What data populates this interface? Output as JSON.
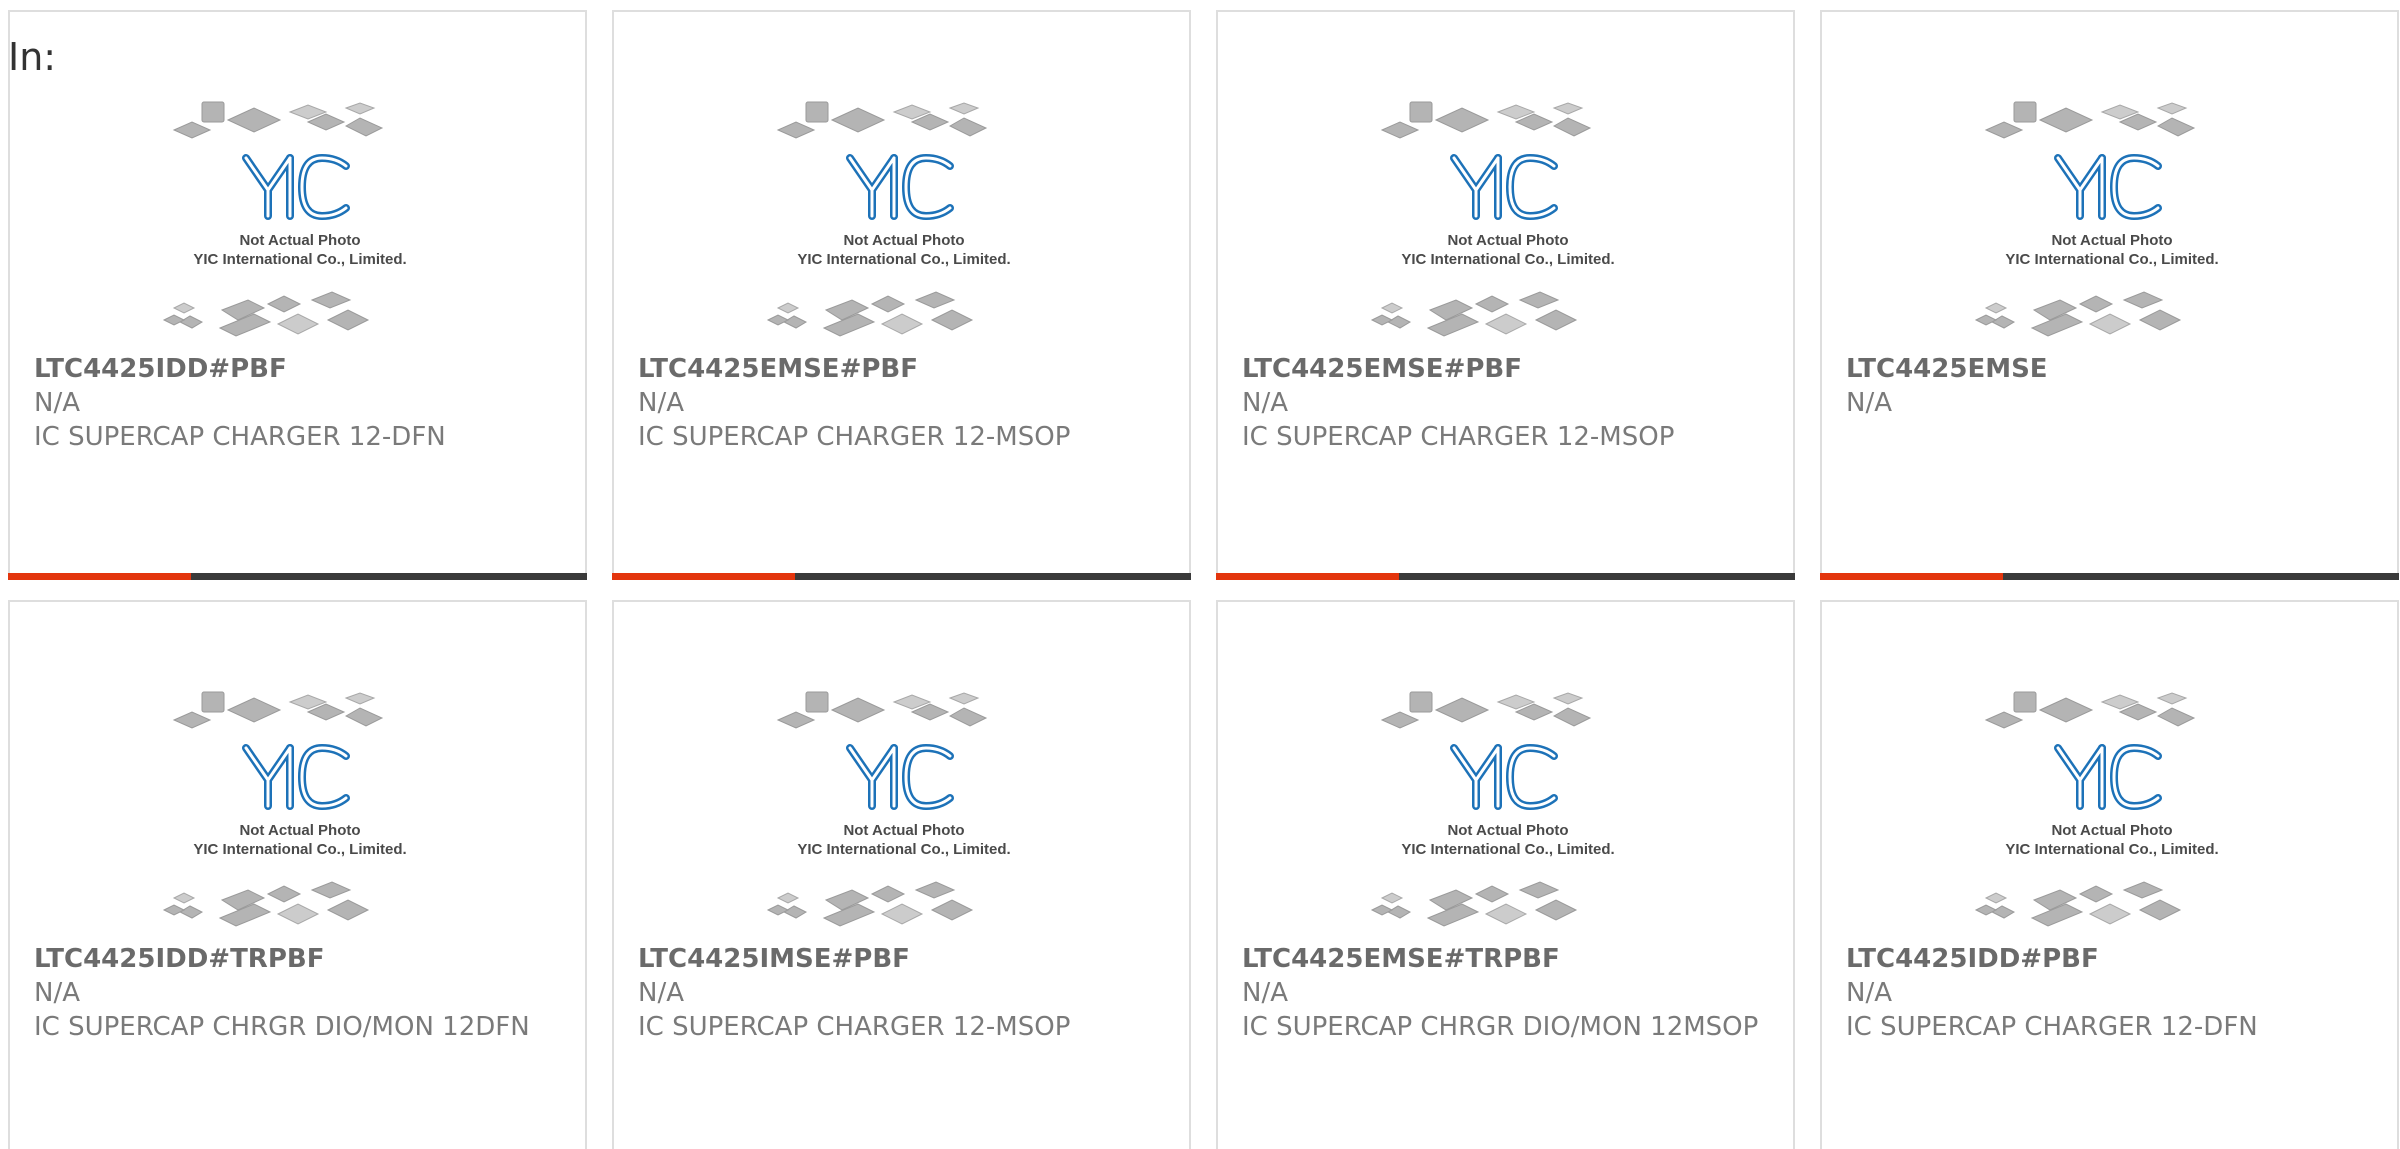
{
  "header": {
    "in_label": "In:"
  },
  "placeholder": {
    "line1": "Not Actual Photo",
    "line2": "YIC International Co., Limited.",
    "logo_text": "YIC"
  },
  "colors": {
    "accent": "#e3350d",
    "bar": "#3a3a3a",
    "logo_blue": "#1d72b8",
    "text": "#6e6e6e",
    "border": "#dedede"
  },
  "products": [
    {
      "part_number": "LTC4425IDD#PBF",
      "manufacturer": "N/A",
      "description": "IC SUPERCAP CHARGER 12-DFN"
    },
    {
      "part_number": "LTC4425EMSE#PBF",
      "manufacturer": "N/A",
      "description": "IC SUPERCAP CHARGER 12-MSOP"
    },
    {
      "part_number": "LTC4425EMSE#PBF",
      "manufacturer": "N/A",
      "description": "IC SUPERCAP CHARGER 12-MSOP"
    },
    {
      "part_number": "LTC4425EMSE",
      "manufacturer": "N/A",
      "description": ""
    },
    {
      "part_number": "LTC4425IDD#TRPBF",
      "manufacturer": "N/A",
      "description": "IC SUPERCAP CHRGR DIO/MON 12DFN"
    },
    {
      "part_number": "LTC4425IMSE#PBF",
      "manufacturer": "N/A",
      "description": "IC SUPERCAP CHARGER 12-MSOP"
    },
    {
      "part_number": "LTC4425EMSE#TRPBF",
      "manufacturer": "N/A",
      "description": "IC SUPERCAP CHRGR DIO/MON 12MSOP"
    },
    {
      "part_number": "LTC4425IDD#PBF",
      "manufacturer": "N/A",
      "description": "IC SUPERCAP CHARGER 12-DFN"
    }
  ]
}
